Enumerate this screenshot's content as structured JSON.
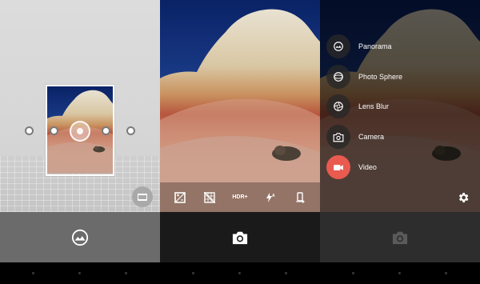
{
  "panorama_screen": {
    "icons": {
      "shutter": "panorama-icon",
      "toggle": "panorama-mode-toggle-icon"
    }
  },
  "camera_screen": {
    "toolbar": [
      {
        "name": "exposure-icon",
        "label": ""
      },
      {
        "name": "grid-off-icon",
        "label": ""
      },
      {
        "name": "hdr-plus-icon",
        "label": "HDR+"
      },
      {
        "name": "flash-auto-icon",
        "label": ""
      },
      {
        "name": "switch-camera-icon",
        "label": ""
      }
    ],
    "icons": {
      "shutter": "camera-icon"
    }
  },
  "mode_menu": {
    "modes": [
      {
        "label": "Panorama",
        "icon": "panorama-icon"
      },
      {
        "label": "Photo Sphere",
        "icon": "photo-sphere-icon"
      },
      {
        "label": "Lens Blur",
        "icon": "lens-blur-icon"
      },
      {
        "label": "Camera",
        "icon": "camera-icon"
      },
      {
        "label": "Video",
        "icon": "video-icon"
      }
    ],
    "active_mode": "Video",
    "accent_color": "#e95a4f"
  }
}
